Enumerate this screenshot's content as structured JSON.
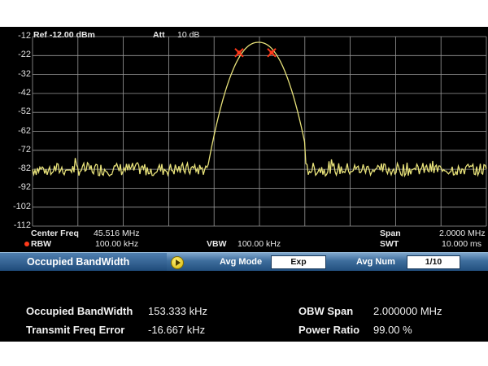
{
  "header": {
    "ref": "Ref -12.00 dBm",
    "att_label": "Att",
    "att_value": "10 dB"
  },
  "y_ticks": [
    "-12",
    "-22",
    "-32",
    "-42",
    "-52",
    "-62",
    "-72",
    "-82",
    "-92",
    "-102",
    "-112"
  ],
  "info": {
    "center_freq_label": "Center Freq",
    "center_freq_value": "45.516 MHz",
    "span_label": "Span",
    "span_value": "2.0000 MHz",
    "rbw_label": "RBW",
    "rbw_value": "100.00 kHz",
    "vbw_label": "VBW",
    "vbw_value": "100.00 kHz",
    "swt_label": "SWT",
    "swt_value": "10.000 ms"
  },
  "menu": {
    "title": "Occupied BandWidth",
    "avg_mode_label": "Avg Mode",
    "avg_mode_value": "Exp",
    "avg_num_label": "Avg Num",
    "avg_num_value": "1/10"
  },
  "results": {
    "obw_label": "Occupied BandWidth",
    "obw_value": "153.333 kHz",
    "tfe_label": "Transmit Freq Error",
    "tfe_value": "-16.667 kHz",
    "span_label": "OBW Span",
    "span_value": "2.000000 MHz",
    "power_label": "Power Ratio",
    "power_value": "99.00 %"
  },
  "colors": {
    "trace": "#e8e27a",
    "grid": "#9a9a9a",
    "marker": "#ff3a1a",
    "background": "#000000"
  },
  "chart_data": {
    "type": "line",
    "ylim": [
      -112,
      -12
    ],
    "xlim_mhz": [
      44.516,
      46.516
    ],
    "grid": true,
    "noise_floor_dbm": -82,
    "peak_dbm": -15,
    "markers_dbm": [
      -20.5,
      -20.5
    ]
  }
}
